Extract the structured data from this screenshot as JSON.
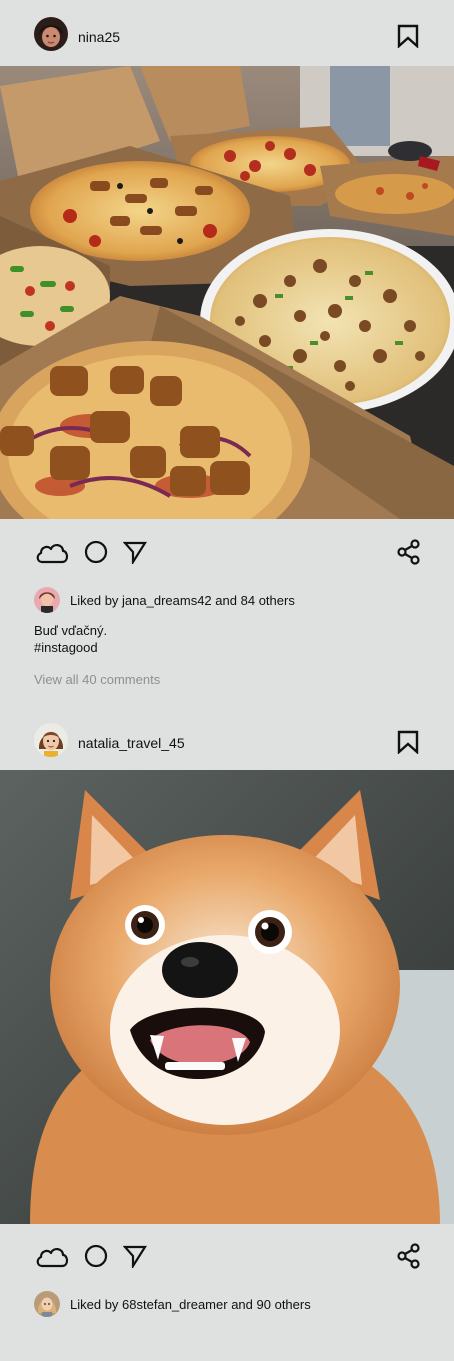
{
  "posts": [
    {
      "username": "nina25",
      "image_subject": "pizzas-in-boxes",
      "liked_by_user": "jana_dreams42",
      "liked_others": "84 others",
      "liked_prefix": "Liked by",
      "liked_and": "and",
      "caption_line1": "Buď vďačný.",
      "caption_line2": "#instagood",
      "view_comments": "View all 40 comments"
    },
    {
      "username": "natalia_travel_45",
      "image_subject": "surprised-shiba-dog",
      "liked_by_user": "68stefan_dreamer",
      "liked_others": "90 others",
      "liked_prefix": "Liked by",
      "liked_and": "and"
    }
  ],
  "icons": {
    "like": "cloud-icon",
    "comment": "circle-icon",
    "share": "send-icon",
    "reshare": "share-icon",
    "save": "bookmark-icon"
  },
  "colors": {
    "background": "#dfe1e0",
    "muted_text": "#8d8f91"
  }
}
